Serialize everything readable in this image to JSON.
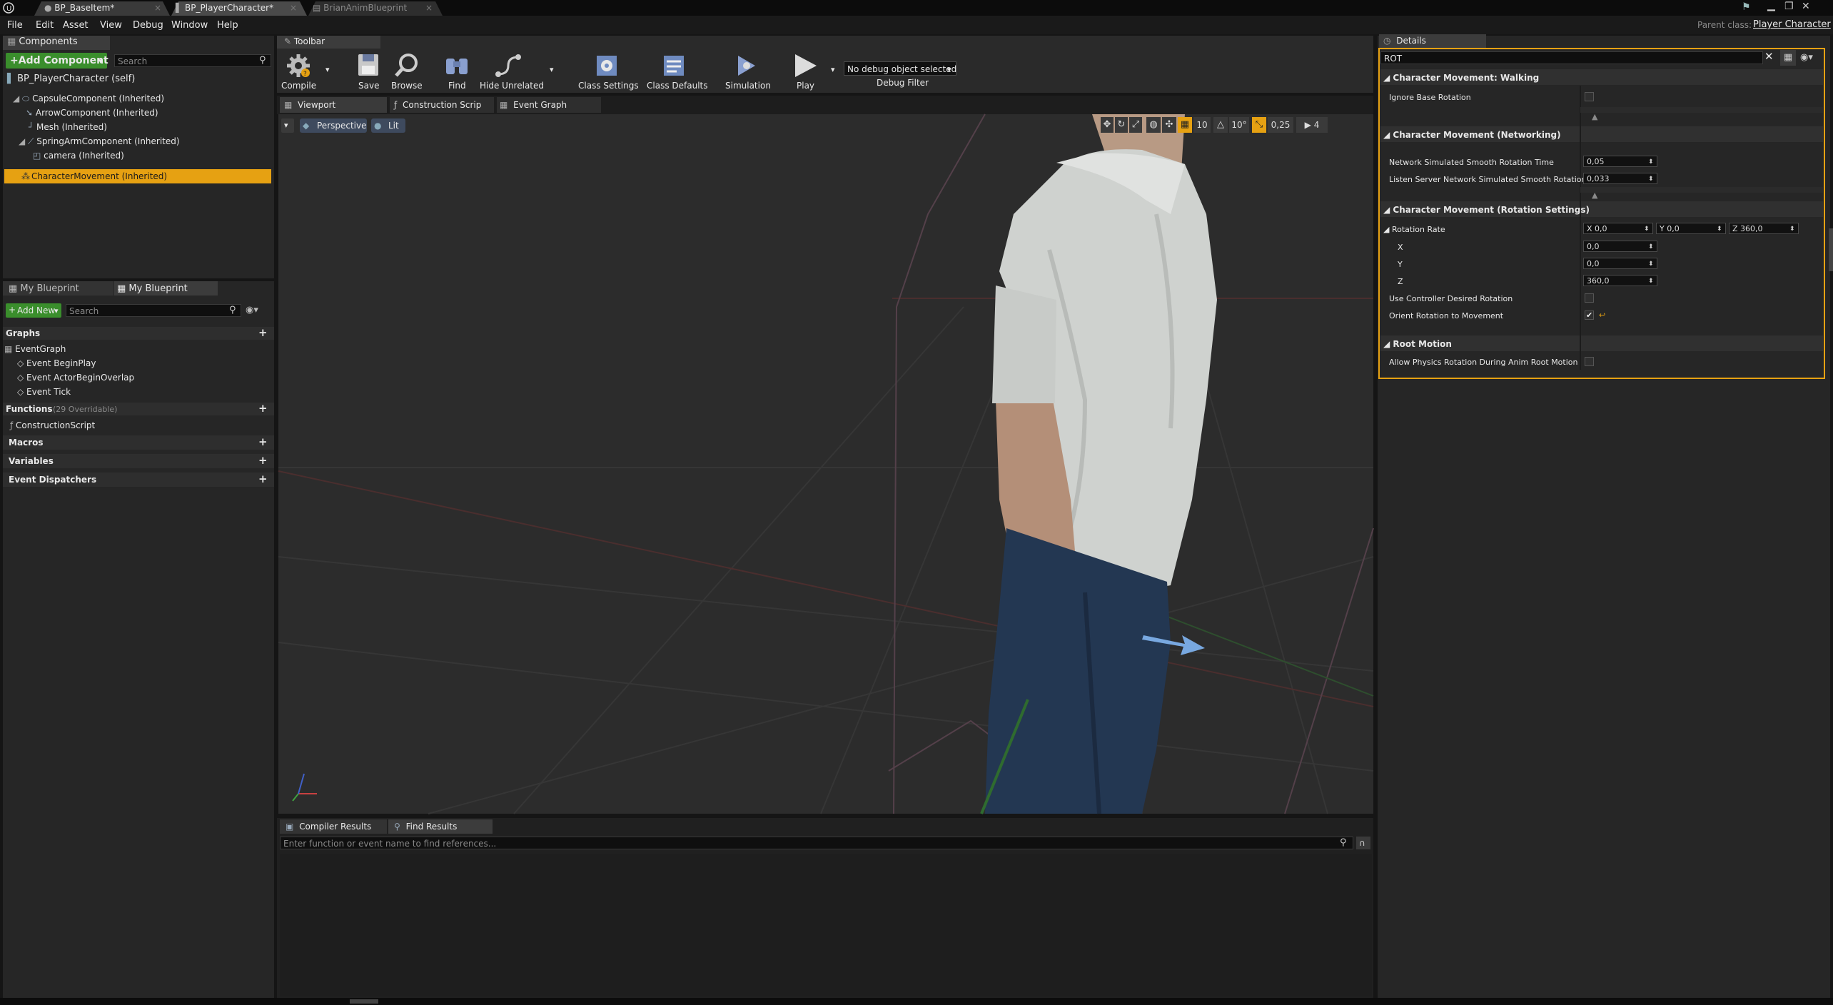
{
  "app": {
    "doc_tabs": [
      "BP_BaseItem*",
      "BP_PlayerCharacter*",
      "BrianAnimBlueprint"
    ],
    "menu": [
      "File",
      "Edit",
      "Asset",
      "View",
      "Debug",
      "Window",
      "Help"
    ],
    "parent_class_label": "Parent class:",
    "parent_class_value": "Player Character"
  },
  "components": {
    "tab": "Components",
    "add_button": "+Add Component",
    "search_placeholder": "Search",
    "self": "BP_PlayerCharacter (self)",
    "tree": [
      "CapsuleComponent (Inherited)",
      "ArrowComponent (Inherited)",
      "Mesh (Inherited)",
      "SpringArmComponent (Inherited)",
      "camera (Inherited)",
      "CharacterMovement (Inherited)"
    ]
  },
  "myblueprint": {
    "tabs": [
      "My Blueprint",
      "My Blueprint"
    ],
    "add_new": "Add New",
    "search_placeholder": "Search",
    "graphs": "Graphs",
    "event_graph": "EventGraph",
    "events": [
      "Event BeginPlay",
      "Event ActorBeginOverlap",
      "Event Tick"
    ],
    "functions": "Functions",
    "functions_count": "(29 Overridable)",
    "construction_script": "ConstructionScript",
    "macros": "Macros",
    "variables": "Variables",
    "event_dispatchers": "Event Dispatchers"
  },
  "toolbar": {
    "tab": "Toolbar",
    "buttons": [
      "Compile",
      "Save",
      "Browse",
      "Find",
      "Hide Unrelated",
      "Class Settings",
      "Class Defaults",
      "Simulation",
      "Play"
    ],
    "debug_select": "No debug object selected",
    "debug_filter": "Debug Filter"
  },
  "editor_tabs": [
    "Viewport",
    "Construction Scrip",
    "Event Graph"
  ],
  "viewport": {
    "perspective": "Perspective",
    "lit": "Lit",
    "grid_snap": "10",
    "rot_snap": "10°",
    "scale_snap": "0,25",
    "cam_speed": "4"
  },
  "bottom": {
    "tabs": [
      "Compiler Results",
      "Find Results"
    ],
    "find_placeholder": "Enter function or event name to find references..."
  },
  "details": {
    "tab": "Details",
    "search_value": "ROT",
    "sections": {
      "walking": "Character Movement: Walking",
      "networking": "Character Movement (Networking)",
      "rotation": "Character Movement (Rotation Settings)",
      "root_motion": "Root Motion"
    },
    "ignore_base_rotation": "Ignore Base Rotation",
    "net_smooth_label": "Network Simulated Smooth Rotation Time",
    "net_smooth_value": "0,05",
    "listen_smooth_label": "Listen Server Network Simulated Smooth Rotation Ti",
    "listen_smooth_value": "0,033",
    "rotation_rate_label": "Rotation Rate",
    "rr_x": "X 0,0",
    "rr_y": "Y 0,0",
    "rr_z": "Z 360,0",
    "x_label": "X",
    "x_value": "0,0",
    "y_label": "Y",
    "y_value": "0,0",
    "z_label": "Z",
    "z_value": "360,0",
    "use_controller": "Use Controller Desired Rotation",
    "orient_rotation": "Orient Rotation to Movement",
    "allow_physics": "Allow Physics Rotation During Anim Root Motion"
  },
  "colors": {
    "accent": "#e6a112",
    "add_green": "#3a8e2c",
    "panel": "#262626",
    "viewport_bg": "#2c2c2c"
  }
}
